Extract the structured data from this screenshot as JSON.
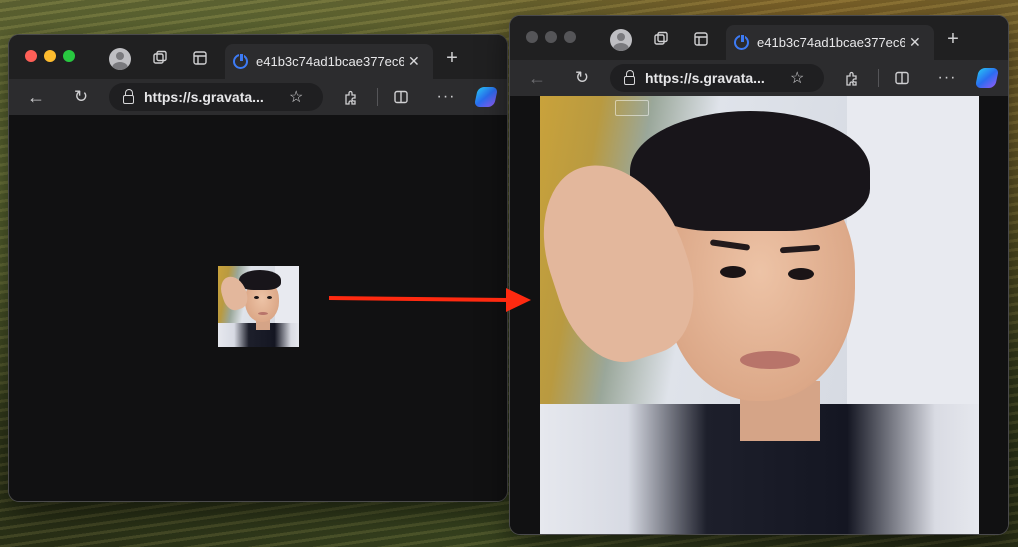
{
  "windows": [
    {
      "id": "left",
      "tab": {
        "title": "e41b3c74ad1bcae377ec6"
      },
      "url": "https://s.gravata...",
      "image_content": "gravatar-photo-small"
    },
    {
      "id": "right",
      "tab": {
        "title": "e41b3c74ad1bcae377ec6"
      },
      "url": "https://s.gravata...",
      "image_content": "gravatar-photo-enlarged"
    }
  ],
  "icons": {
    "profile": "profile-icon",
    "workspaces": "workspaces-icon",
    "tab_actions": "tab-actions-icon",
    "favicon": "power-icon",
    "close": "close-icon",
    "new_tab": "plus-icon",
    "back": "back-icon",
    "refresh": "refresh-icon",
    "lock": "lock-icon",
    "favorite": "star-icon",
    "extensions": "puzzle-icon",
    "split": "split-screen-icon",
    "more": "more-icon",
    "copilot": "copilot-icon"
  },
  "colors": {
    "arrow": "#ff2a10",
    "favicon": "#3d7bf5"
  }
}
